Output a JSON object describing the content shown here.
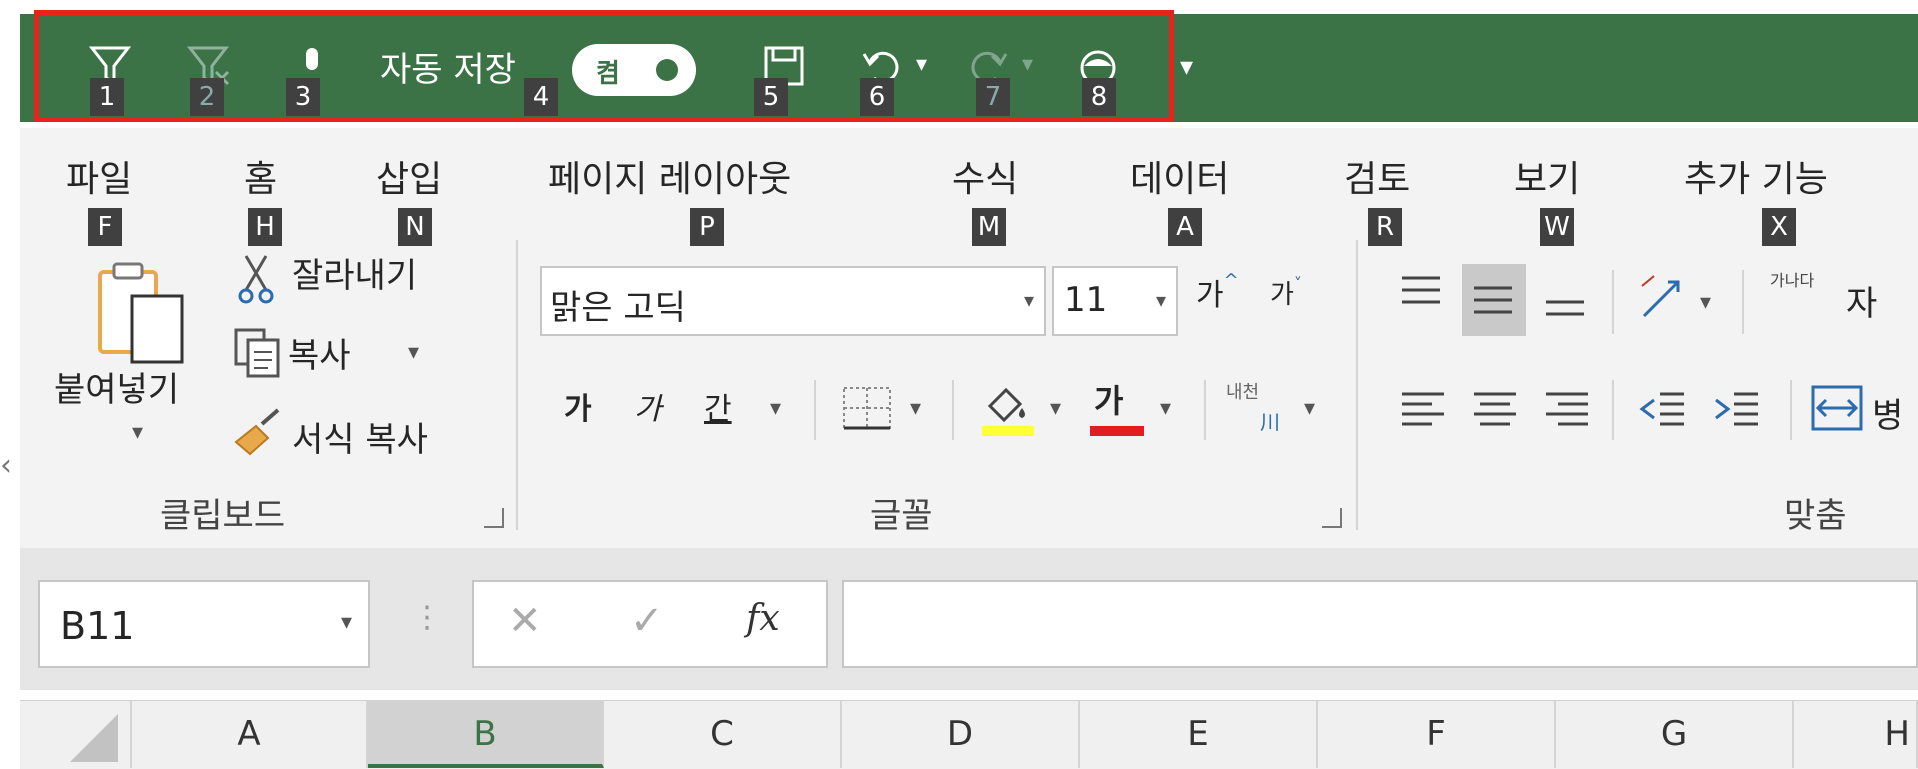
{
  "colors": {
    "title_bar": "#3b7347",
    "highlight_border": "#e8231b",
    "keytip_bg": "#404040",
    "accent": "#3b7347"
  },
  "qat": {
    "keytips": [
      "1",
      "2",
      "3",
      "4",
      "5",
      "6",
      "7",
      "8"
    ],
    "autosave_label": "자동 저장",
    "autosave_state": "켬",
    "icons": [
      "filter-icon",
      "clear-filter-icon",
      "mic-icon",
      "save-icon",
      "undo-icon",
      "redo-icon",
      "accessibility-icon",
      "customize-qat-icon"
    ]
  },
  "tabs": [
    {
      "label": "파일",
      "keytip": "F"
    },
    {
      "label": "홈",
      "keytip": "H"
    },
    {
      "label": "삽입",
      "keytip": "N"
    },
    {
      "label": "페이지 레이아웃",
      "keytip": "P"
    },
    {
      "label": "수식",
      "keytip": "M"
    },
    {
      "label": "데이터",
      "keytip": "A"
    },
    {
      "label": "검토",
      "keytip": "R"
    },
    {
      "label": "보기",
      "keytip": "W"
    },
    {
      "label": "추가 기능",
      "keytip": "X"
    }
  ],
  "clipboard": {
    "paste": "붙여넣기",
    "cut": "잘라내기",
    "copy": "복사",
    "format_painter": "서식 복사",
    "group_label": "클립보드"
  },
  "font": {
    "name": "맑은 고딕",
    "size": "11",
    "grow": "가",
    "shrink": "가",
    "bold": "가",
    "italic": "가",
    "underline": "간",
    "font_color_glyph": "가",
    "phonetic_top": "내천",
    "phonetic_bottom": "川",
    "group_label": "글꼴"
  },
  "alignment": {
    "wrap_text_glyph": "가나다",
    "wrap_partial": "자",
    "merge_partial": "병",
    "group_label": "맞춤"
  },
  "formula_bar": {
    "name_box": "B11",
    "fx": "fx",
    "value": ""
  },
  "columns": [
    "A",
    "B",
    "C",
    "D",
    "E",
    "F",
    "G",
    "H"
  ],
  "selected_column": "B"
}
